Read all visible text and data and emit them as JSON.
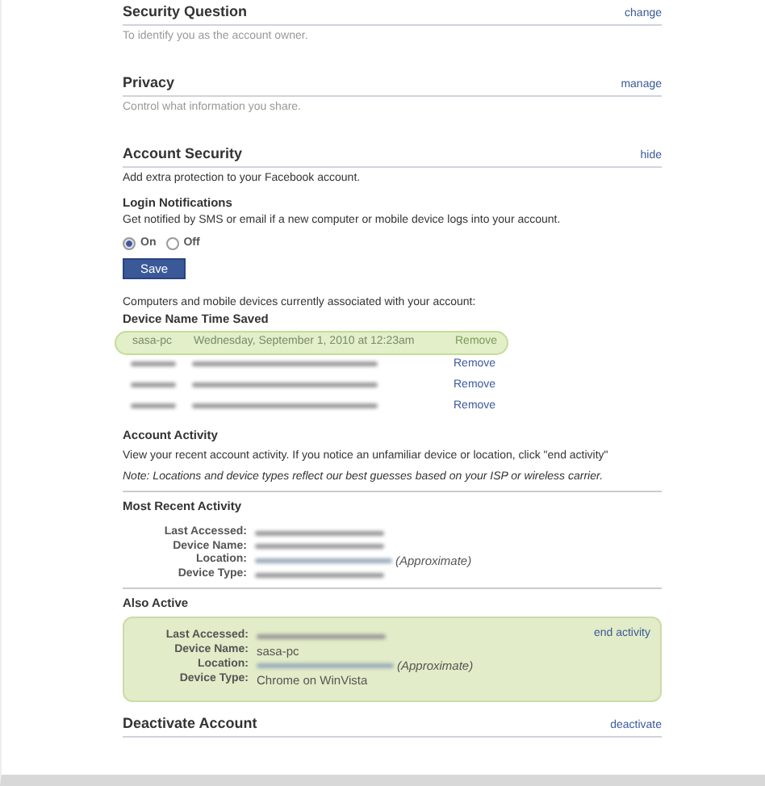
{
  "sections": [
    {
      "title": "Security Question",
      "action": "change",
      "description": "To identify you as the account owner."
    },
    {
      "title": "Privacy",
      "action": "manage",
      "description": "Control what information you share."
    }
  ],
  "account_security": {
    "title": "Account Security",
    "action": "hide",
    "description": "Add extra protection to your Facebook account.",
    "login_notifications": {
      "title": "Login Notifications",
      "description": "Get notified by SMS or email if a new computer or mobile device logs into your account.",
      "options": [
        {
          "label": "On",
          "selected": true
        },
        {
          "label": "Off",
          "selected": false
        }
      ],
      "button": "Save"
    },
    "devices_intro": "Computers and mobile devices currently associated with your account:",
    "devices_header": "Device Name Time Saved",
    "devices": [
      {
        "kind": "shown",
        "current": true,
        "name": "sasa-pc",
        "time": "Wednesday, September 1, 2010 at 12:23am",
        "action": "Remove"
      },
      {
        "kind": "redacted",
        "current": false,
        "action": "Remove"
      },
      {
        "kind": "redacted",
        "current": false,
        "action": "Remove"
      },
      {
        "kind": "redacted",
        "current": false,
        "action": "Remove"
      }
    ],
    "activity": {
      "title": "Account Activity",
      "description": "View your recent account activity. If you notice an unfamiliar device or location, click \"end activity\"",
      "note": "Note: Locations and device types reflect our best guesses based on your ISP or wireless carrier."
    }
  },
  "most_recent": {
    "title": "Most Recent Activity",
    "fields": [
      {
        "label": "Last Accessed:",
        "kind": "redacted"
      },
      {
        "label": "Device Name:",
        "kind": "redacted"
      },
      {
        "label": "Location:",
        "kind": "redacted",
        "suffix": "(Approximate)"
      },
      {
        "label": "Device Type:",
        "kind": "redacted"
      }
    ]
  },
  "also_active": {
    "title": "Also Active",
    "action": "end activity",
    "fields": [
      {
        "label": "Last Accessed:",
        "kind": "redacted"
      },
      {
        "label": "Device Name:",
        "kind": "text",
        "value": "sasa-pc"
      },
      {
        "label": "Location:",
        "kind": "redacted",
        "suffix": "(Approximate)"
      },
      {
        "label": "Device Type:",
        "kind": "text",
        "value": "Chrome on WinVista"
      }
    ]
  },
  "deactivate": {
    "title": "Deactivate Account",
    "action": "deactivate"
  }
}
